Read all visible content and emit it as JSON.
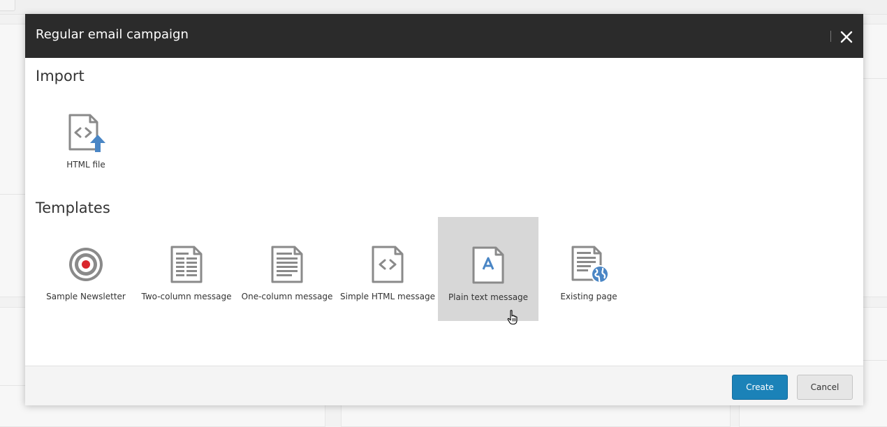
{
  "modal": {
    "title": "Regular email campaign",
    "close_icon": "close-icon"
  },
  "import": {
    "title": "Import",
    "items": [
      {
        "label": "HTML file",
        "icon": "html-file-upload-icon"
      }
    ]
  },
  "templates": {
    "title": "Templates",
    "items": [
      {
        "label": "Sample Newsletter",
        "icon": "target-icon"
      },
      {
        "label": "Two-column message",
        "icon": "two-column-document-icon"
      },
      {
        "label": "One-column message",
        "icon": "one-column-document-icon"
      },
      {
        "label": "Simple HTML message",
        "icon": "html-document-icon"
      },
      {
        "label": "Plain text message",
        "icon": "plain-text-document-icon",
        "selected": true
      },
      {
        "label": "Existing page",
        "icon": "existing-page-globe-icon"
      }
    ]
  },
  "footer": {
    "create_label": "Create",
    "cancel_label": "Cancel"
  },
  "colors": {
    "header_bg": "#2b2b2b",
    "accent_blue": "#4a86c5",
    "create_button": "#1b82b8",
    "selected_tile": "#d7d7d7",
    "target_red": "#d9262c"
  }
}
